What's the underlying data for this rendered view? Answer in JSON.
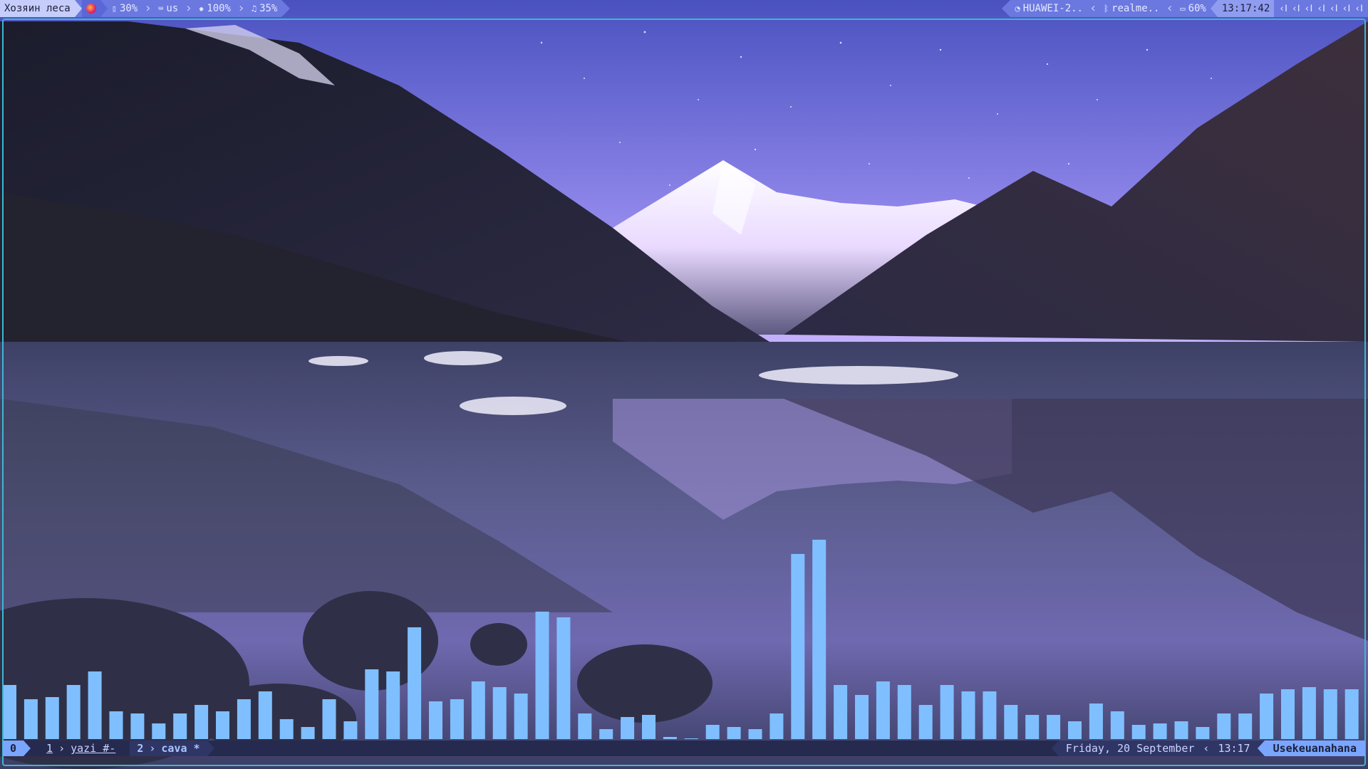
{
  "topbar": {
    "left": {
      "workspace_title": "Хозяин леса",
      "brightness": "30%",
      "keyboard_layout": "us",
      "light": "100%",
      "volume": "35%"
    },
    "right": {
      "wifi": "HUAWEI-2..",
      "bluetooth": "realme..",
      "battery": "60%",
      "clock": "13:17:42",
      "tray_icons": [
        "tray-icon-1",
        "tray-icon-2",
        "tray-icon-3",
        "tray-icon-4",
        "tray-icon-5",
        "tray-icon-6",
        "tray-icon-7"
      ]
    }
  },
  "tmux": {
    "session": "0",
    "windows": [
      {
        "index": "1",
        "name": "yazi #-"
      },
      {
        "index": "2",
        "name": "cava *"
      }
    ],
    "date": "Friday, 20 September",
    "time": "13:17",
    "host": "Usekeuanahana"
  },
  "cava": {
    "color": "#7fbfff",
    "levels": [
      0.27,
      0.2,
      0.21,
      0.27,
      0.34,
      0.14,
      0.13,
      0.08,
      0.13,
      0.17,
      0.14,
      0.2,
      0.24,
      0.1,
      0.06,
      0.2,
      0.09,
      0.35,
      0.34,
      0.56,
      0.19,
      0.2,
      0.29,
      0.26,
      0.23,
      0.64,
      0.61,
      0.13,
      0.05,
      0.11,
      0.12,
      0.01,
      0,
      0.07,
      0.06,
      0.05,
      0.13,
      0.93,
      1.0,
      0.27,
      0.22,
      0.29,
      0.27,
      0.17,
      0.27,
      0.24,
      0.24,
      0.17,
      0.12,
      0.12,
      0.09,
      0.18,
      0.14,
      0.07,
      0.08,
      0.09,
      0.06,
      0.13,
      0.13,
      0.23,
      0.25,
      0.26,
      0.25,
      0.25
    ]
  },
  "colors": {
    "frame": "#3fb6d0",
    "bar_accent": "#7aa6ff",
    "sky_top": "#4b4fb4",
    "sky_bottom": "#b7a9ff",
    "lake": "#565a8a"
  }
}
